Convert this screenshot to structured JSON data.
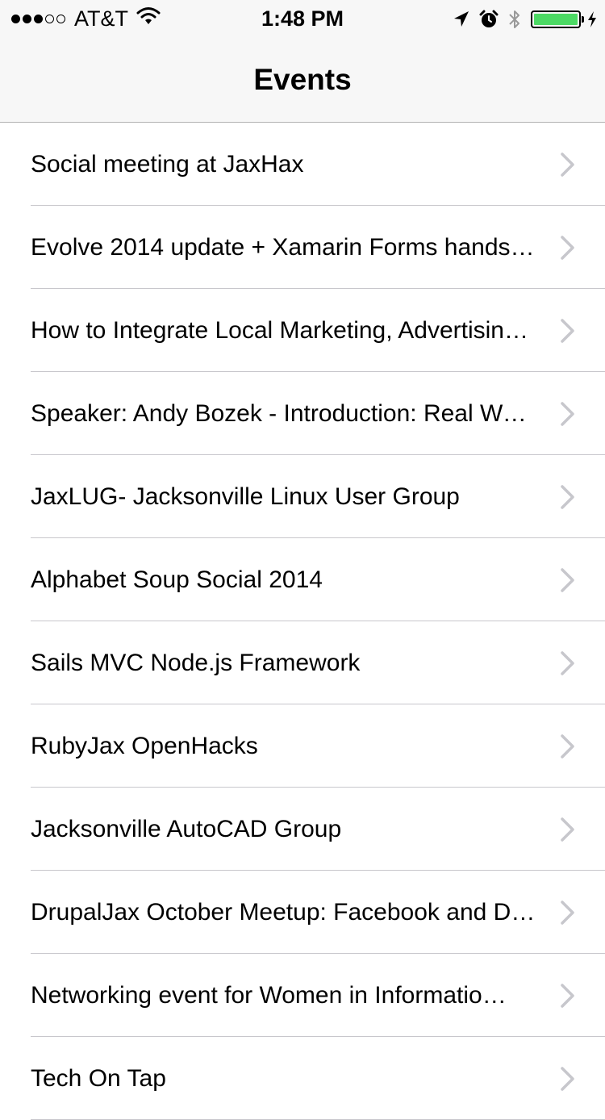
{
  "status_bar": {
    "carrier": "AT&T",
    "time": "1:48 PM",
    "signal_bars_filled": 3,
    "signal_bars_total": 5,
    "battery_level": 1.0,
    "battery_color": "#4cd964",
    "icons": [
      "wifi-icon",
      "location-arrow-icon",
      "alarm-icon",
      "bluetooth-icon",
      "battery-icon",
      "charging-bolt-icon"
    ]
  },
  "nav": {
    "title": "Events"
  },
  "events": [
    {
      "title": "Social meeting at JaxHax"
    },
    {
      "title": "Evolve 2014 update + Xamarin Forms hands…"
    },
    {
      "title": "How to Integrate Local Marketing, Advertisin…"
    },
    {
      "title": "Speaker: Andy Bozek - Introduction: Real Wo…"
    },
    {
      "title": "JaxLUG- Jacksonville Linux User Group"
    },
    {
      "title": "Alphabet Soup Social 2014"
    },
    {
      "title": "Sails MVC Node.js Framework"
    },
    {
      "title": "RubyJax OpenHacks"
    },
    {
      "title": "Jacksonville AutoCAD Group"
    },
    {
      "title": "DrupalJax October Meetup: Facebook and D…"
    },
    {
      "title": "Networking event for Women in Informatio…"
    },
    {
      "title": "Tech On Tap"
    }
  ],
  "colors": {
    "bar_background": "#f7f7f7",
    "separator": "#c8c7cc",
    "chevron": "#c7c7cc"
  }
}
